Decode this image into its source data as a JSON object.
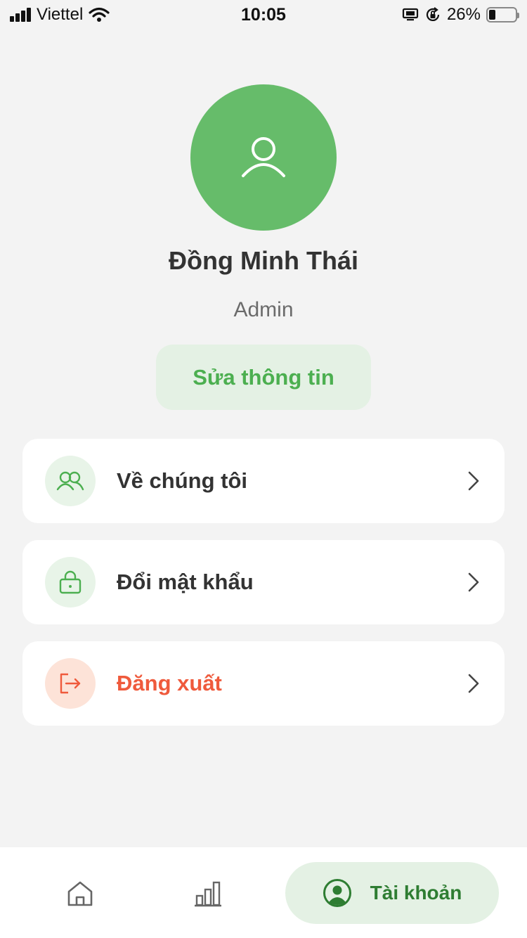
{
  "status_bar": {
    "carrier": "Viettel",
    "time": "10:05",
    "battery": "26%",
    "battery_fraction": 0.26
  },
  "profile": {
    "name": "Đồng Minh Thái",
    "role": "Admin",
    "avatar_icon": "user-icon",
    "avatar_color": "#66bc6a",
    "edit_label": "Sửa thông tin"
  },
  "menu": [
    {
      "label": "Về chúng tôi",
      "icon": "users-icon",
      "style": "normal"
    },
    {
      "label": "Đổi mật khẩu",
      "icon": "lock-icon",
      "style": "normal"
    },
    {
      "label": "Đăng xuất",
      "icon": "logout-icon",
      "style": "danger"
    }
  ],
  "bottom_nav": {
    "items": [
      {
        "icon": "home-icon",
        "active": false
      },
      {
        "icon": "bar-chart-icon",
        "active": false
      },
      {
        "icon": "account-icon",
        "label": "Tài khoản",
        "active": true
      }
    ]
  },
  "colors": {
    "accent": "#4caf50",
    "danger": "#ef5a3c",
    "background": "#f3f3f3"
  }
}
